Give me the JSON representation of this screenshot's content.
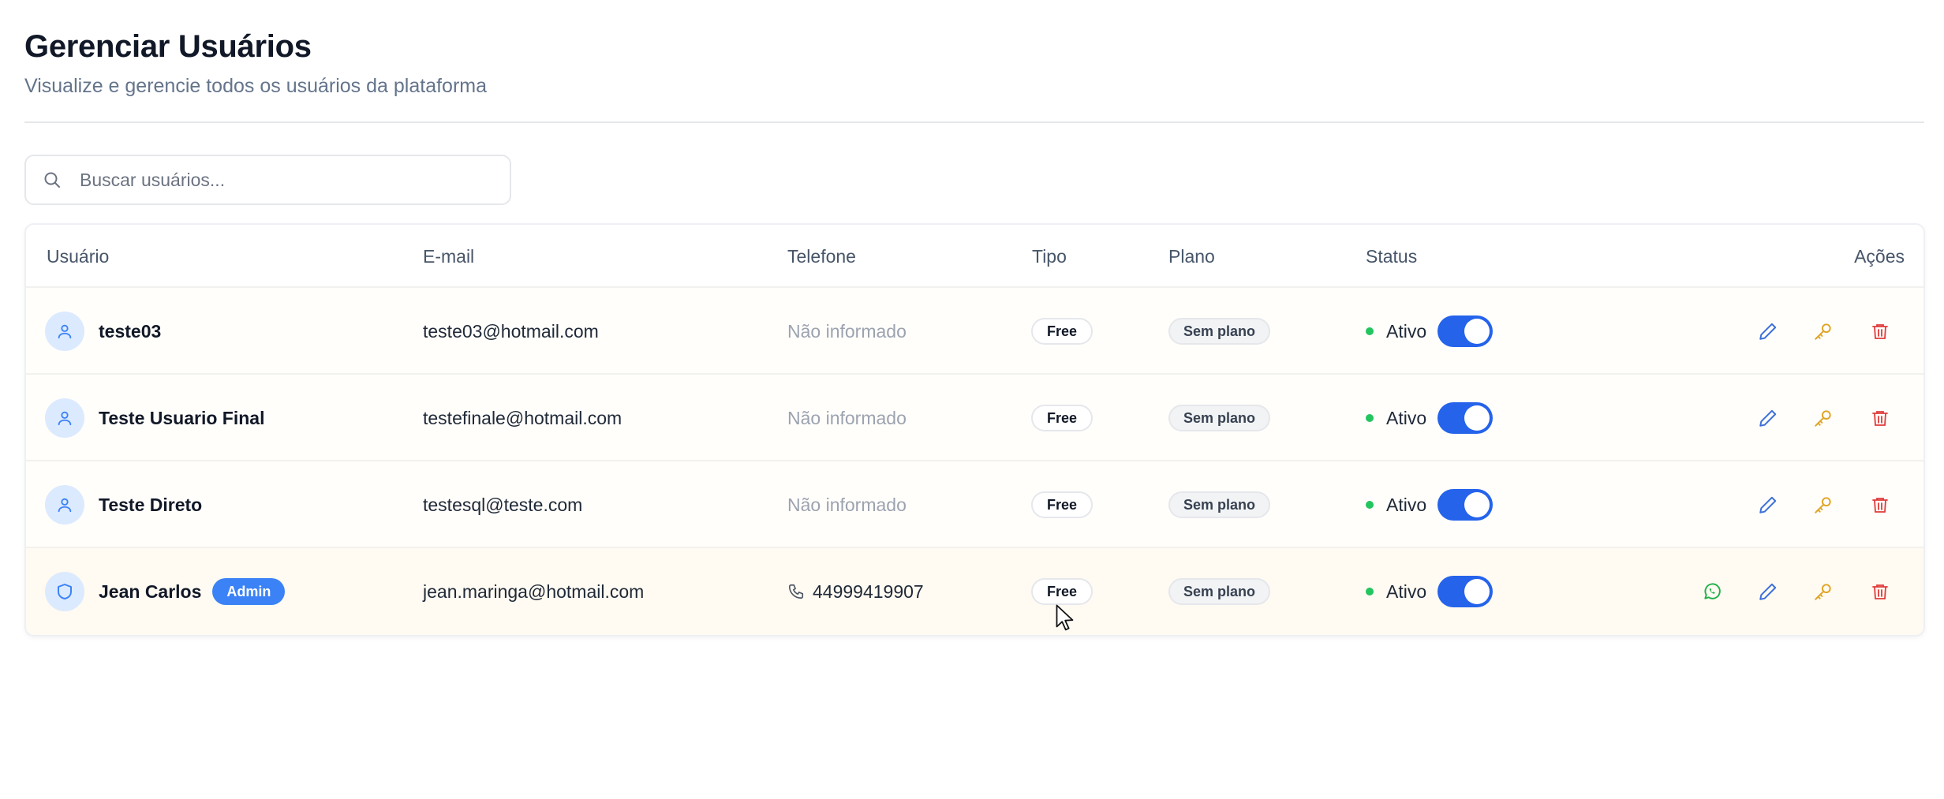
{
  "page": {
    "title": "Gerenciar Usuários",
    "subtitle": "Visualize e gerencie todos os usuários da plataforma"
  },
  "search": {
    "placeholder": "Buscar usuários...",
    "value": ""
  },
  "table": {
    "headers": {
      "user": "Usuário",
      "email": "E-mail",
      "phone": "Telefone",
      "type": "Tipo",
      "plan": "Plano",
      "status": "Status",
      "actions": "Ações"
    },
    "rows": [
      {
        "name": "teste03",
        "email": "teste03@hotmail.com",
        "phone": "Não informado",
        "type": "Free",
        "plan": "Sem plano",
        "status": "Ativo",
        "active": true
      },
      {
        "name": "Teste Usuario Final",
        "email": "testefinale@hotmail.com",
        "phone": "Não informado",
        "type": "Free",
        "plan": "Sem plano",
        "status": "Ativo",
        "active": true
      },
      {
        "name": "Teste Direto",
        "email": "testesql@teste.com",
        "phone": "Não informado",
        "type": "Free",
        "plan": "Sem plano",
        "status": "Ativo",
        "active": true
      },
      {
        "name": "Jean Carlos",
        "badge": "Admin",
        "email": "jean.maringa@hotmail.com",
        "phone": "44999419907",
        "type": "Free",
        "plan": "Sem plano",
        "status": "Ativo",
        "active": true
      }
    ]
  },
  "icons": {
    "search": "search-icon",
    "user_avatar": "user-icon",
    "admin_avatar": "shield-icon",
    "phone": "phone-icon",
    "whatsapp": "whatsapp-icon",
    "edit": "pencil-icon",
    "password": "key-icon",
    "delete": "trash-icon"
  },
  "colors": {
    "accent": "#2563eb",
    "admin_badge": "#3b82f6",
    "status_active": "#22c55e",
    "edit": "#3b6fd8",
    "key": "#e0a526",
    "delete": "#e03a3a",
    "whatsapp": "#22b14c"
  }
}
